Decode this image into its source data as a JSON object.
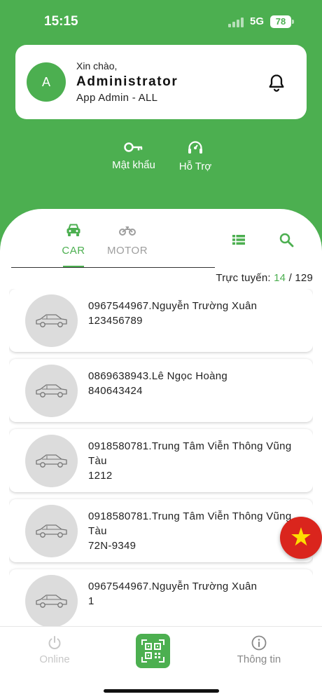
{
  "status_bar": {
    "time": "15:15",
    "network": "5G",
    "battery": "78"
  },
  "user_card": {
    "avatar_initial": "A",
    "greeting": "Xin chào,",
    "name": "Administrator",
    "role": "App Admin - ALL",
    "icon": "bell-icon"
  },
  "quick_actions": [
    {
      "label": "Mật khẩu",
      "icon": "key-icon"
    },
    {
      "label": "Hỗ Trợ",
      "icon": "headset-icon"
    }
  ],
  "tabs": [
    {
      "label": "CAR",
      "icon": "car-icon",
      "active": true
    },
    {
      "label": "MOTOR",
      "icon": "motorbike-icon",
      "active": false
    }
  ],
  "toolbar_icons": [
    "list-icon",
    "search-icon"
  ],
  "online": {
    "label": "Trực tuyến:",
    "count": "14",
    "separator": "/",
    "total": "129"
  },
  "vehicles": [
    {
      "title": "0967544967.Nguyễn Trường Xuân",
      "plate": "123456789"
    },
    {
      "title": "0869638943.Lê Ngọc Hoàng",
      "plate": "840643424"
    },
    {
      "title": "0918580781.Trung Tâm Viễn Thông Vũng Tàu",
      "plate": "1212"
    },
    {
      "title": "0918580781.Trung Tâm Viễn Thông Vũng Tàu",
      "plate": "72N-9349"
    },
    {
      "title": "0967544967.Nguyễn Trường Xuân",
      "plate": "1"
    }
  ],
  "language_button": {
    "icon": "vietnam-flag-icon"
  },
  "bottom_nav": [
    {
      "label": "Online",
      "icon": "power-icon"
    },
    {
      "label": "",
      "icon": "qr-code-icon"
    },
    {
      "label": "Thông tin",
      "icon": "info-icon"
    }
  ],
  "colors": {
    "primary": "#4CAF50",
    "flag_red": "#da251d",
    "flag_star": "#ffde00",
    "inactive": "#9e9e9e"
  }
}
